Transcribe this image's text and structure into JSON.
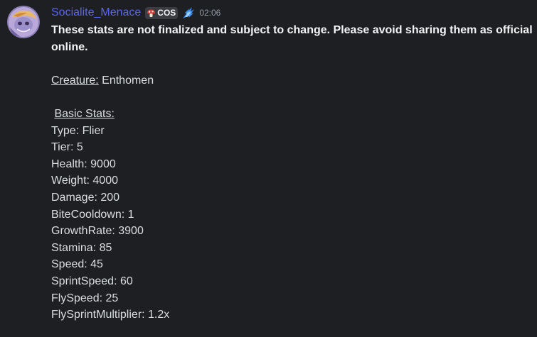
{
  "message": {
    "author": "Socialite_Menace",
    "tag_label": "COS",
    "tag_icon": "mushroom-icon",
    "role_icon": "blue-splash-icon",
    "timestamp": "02:06",
    "colors": {
      "background": "#1e1f22",
      "username": "#5865f2",
      "text": "#dbdee1",
      "timestamp": "#949ba4"
    },
    "notice": "These stats are not finalized and subject to change. Please avoid sharing them as official online.",
    "creature_label": "Creature:",
    "creature_value": " Enthomen",
    "basic_stats_heading": "Basic Stats:",
    "stats": [
      "Type: Flier",
      "Tier: 5",
      "Health: 9000",
      "Weight: 4000",
      "Damage: 200",
      "BiteCooldown: 1",
      "GrowthRate: 3900",
      "Stamina: 85",
      "Speed: 45",
      "SprintSpeed: 60",
      "FlySpeed: 25",
      "FlySprintMultiplier: 1.2x"
    ]
  }
}
